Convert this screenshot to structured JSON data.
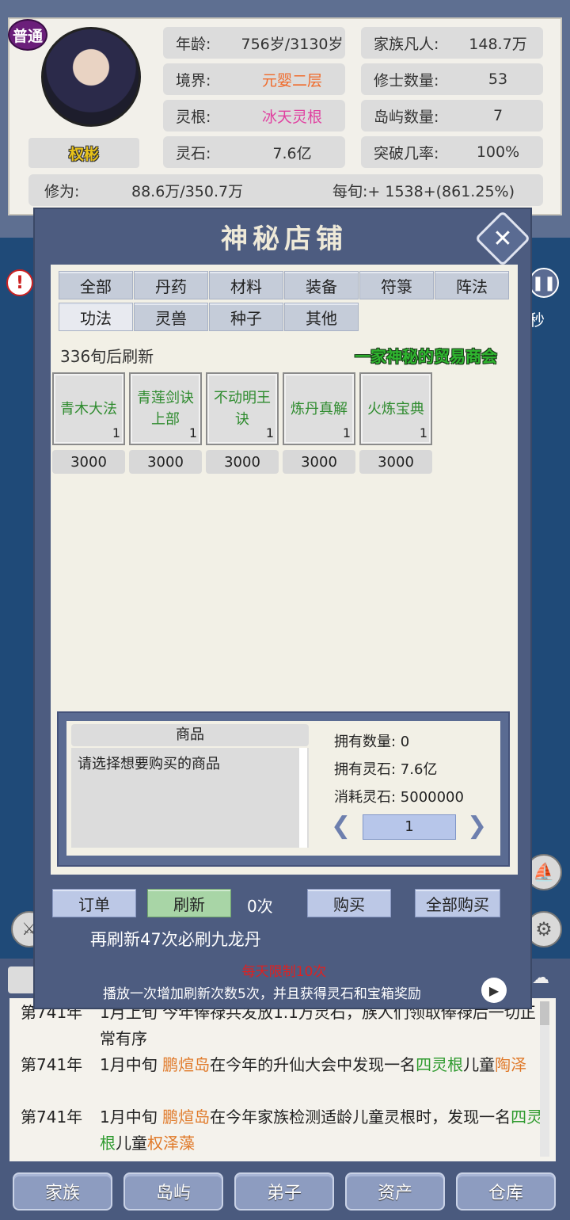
{
  "profile": {
    "rank_badge": "普通",
    "name": "权彬",
    "stats_left": [
      {
        "key": "年龄:",
        "value": "756岁/3130岁",
        "color": "#333333"
      },
      {
        "key": "境界:",
        "value": "元婴二层",
        "color": "#f06a2a"
      },
      {
        "key": "灵根:",
        "value": "冰天灵根",
        "color": "#e040a0"
      },
      {
        "key": "灵石:",
        "value": "7.6亿",
        "color": "#333333"
      }
    ],
    "stats_right": [
      {
        "key": "家族凡人:",
        "value": "148.7万"
      },
      {
        "key": "修士数量:",
        "value": "53"
      },
      {
        "key": "岛屿数量:",
        "value": "7"
      },
      {
        "key": "突破几率:",
        "value": "100%"
      }
    ],
    "cultivation_label": "修为:",
    "cultivation_value": "88.6万/350.7万",
    "per_turn": "每旬:+ 1538+(861.25%)"
  },
  "side": {
    "pause_text": "秒"
  },
  "shop": {
    "title": "神秘店铺",
    "tabs_row1": [
      "全部",
      "丹药",
      "材料",
      "装备",
      "符箓",
      "阵法"
    ],
    "tabs_row2": [
      "功法",
      "灵兽",
      "种子",
      "其他"
    ],
    "refresh_countdown": "336旬后刷新",
    "merchant": "一家神秘的贸易商会",
    "goods": [
      {
        "name_line1": "青木大法",
        "name_line2": "",
        "count": "1",
        "price": "3000"
      },
      {
        "name_line1": "青莲剑诀",
        "name_line2": "上部",
        "count": "1",
        "price": "3000"
      },
      {
        "name_line1": "不动明王",
        "name_line2": "诀",
        "count": "1",
        "price": "3000"
      },
      {
        "name_line1": "炼丹真解",
        "name_line2": "",
        "count": "1",
        "price": "3000"
      },
      {
        "name_line1": "火炼宝典",
        "name_line2": "",
        "count": "1",
        "price": "3000"
      }
    ],
    "detail": {
      "header": "商品",
      "placeholder": "请选择想要购买的商品",
      "owned": "拥有数量: 0",
      "spirit_stones": "拥有灵石: 7.6亿",
      "cost": "消耗灵石: 5000000",
      "quantity": "1"
    },
    "buttons": {
      "order": "订单",
      "refresh": "刷新",
      "refresh_count": "0次",
      "buy": "购买",
      "buy_all": "全部购买"
    },
    "refresh_hint": "再刷新47次必刷九龙丹",
    "daily_limit": "每天限制10次",
    "ad_hint": "播放一次增加刷新次数5次，并且获得灵石和宝箱奖励"
  },
  "log": [
    {
      "year": "第741年",
      "segments": [
        {
          "t": "1月上旬 今年俸禄共发放1.1万灵石，族人们领取俸禄后一切正常有序",
          "c": ""
        }
      ]
    },
    {
      "year": "第741年",
      "segments": [
        {
          "t": "1月中旬 ",
          "c": ""
        },
        {
          "t": "鹏煊岛",
          "c": "o"
        },
        {
          "t": "在今年的升仙大会中发现一名",
          "c": ""
        },
        {
          "t": "四灵根",
          "c": "g"
        },
        {
          "t": "儿童",
          "c": ""
        },
        {
          "t": "陶泽",
          "c": "o"
        }
      ]
    },
    {
      "year": "第741年",
      "segments": [
        {
          "t": "1月中旬 ",
          "c": ""
        },
        {
          "t": "鹏煊岛",
          "c": "o"
        },
        {
          "t": "在今年家族检测适龄儿童灵根时，发现一名",
          "c": ""
        },
        {
          "t": "四灵根",
          "c": "g"
        },
        {
          "t": "儿童",
          "c": ""
        },
        {
          "t": "权泽藻",
          "c": "o"
        }
      ]
    }
  ],
  "nav": [
    "家族",
    "岛屿",
    "弟子",
    "资产",
    "仓库"
  ]
}
